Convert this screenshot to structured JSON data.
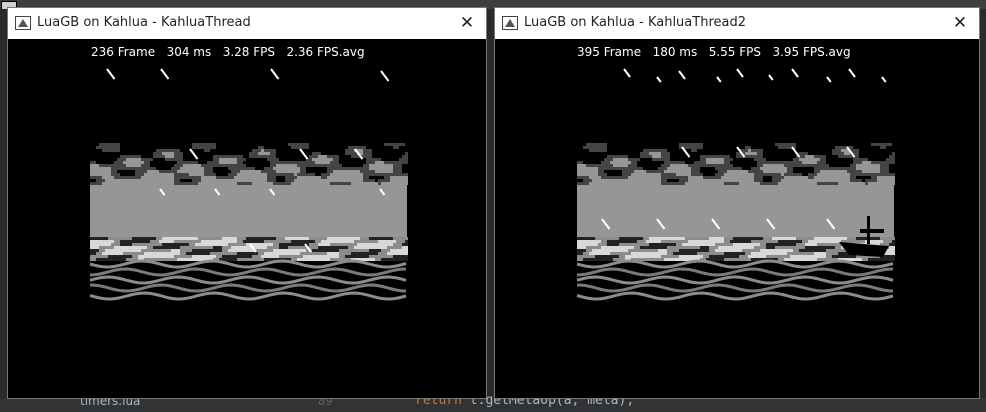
{
  "ide": {
    "line_numbers": "89",
    "code_line": "return t.getMetaOp(a, meta);",
    "code_keyword": "return",
    "code_rest": "t.getMetaOp(a, meta);",
    "file_item": "timers.lua"
  },
  "windows": [
    {
      "title": "LuaGB on Kahlua - KahluaThread",
      "stats": {
        "frame": "236 Frame",
        "ms": "304 ms",
        "fps": "3.28 FPS",
        "avg": "2.36 FPS.avg"
      },
      "has_boat": false
    },
    {
      "title": "LuaGB on Kahlua - KahluaThread2",
      "stats": {
        "frame": "395 Frame",
        "ms": "180 ms",
        "fps": "5.55 FPS",
        "avg": "3.95 FPS.avg"
      },
      "has_boat": true
    }
  ],
  "close_glyph": "✕",
  "colors": {
    "sky": "#969696",
    "light": "#d8d8d8",
    "mid": "#8c8c8c",
    "background": "#000000"
  }
}
